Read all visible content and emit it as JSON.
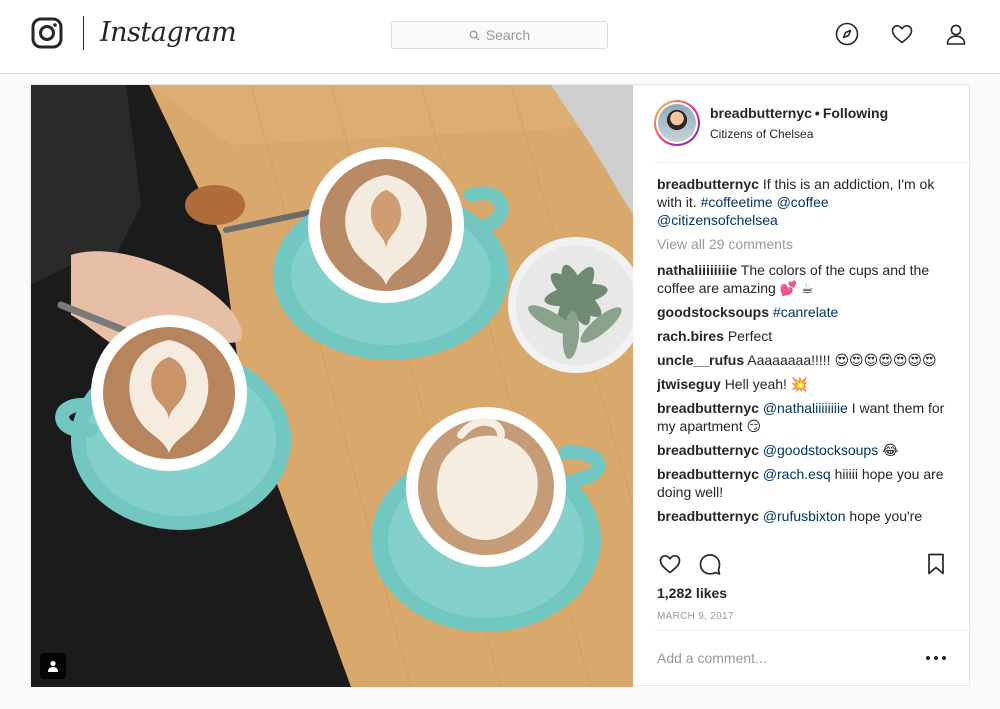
{
  "header": {
    "wordmark": "Instagram",
    "search_placeholder": "Search",
    "icons": [
      "instagram-glyph-icon",
      "compass-icon",
      "heart-icon",
      "profile-icon"
    ]
  },
  "post": {
    "username": "breadbutternyc",
    "separator": "•",
    "follow_status": "Following",
    "location": "Citizens of Chelsea",
    "caption": {
      "user": "breadbutternyc",
      "text": "If this is an addiction, I'm ok with it.",
      "tags": [
        "#coffeetime",
        "@coffee",
        "@citizensofchelsea"
      ]
    },
    "view_all": "View all 29 comments",
    "comments": [
      {
        "user": "nathaliiiiiiiie",
        "text": "The colors of the cups and the coffee are amazing 💕 ☕"
      },
      {
        "user": "goodstocksoups",
        "tag": "#canrelate",
        "text": ""
      },
      {
        "user": "rach.bires",
        "text": "Perfect"
      },
      {
        "user": "uncle__rufus",
        "text": "Aaaaaaaa!!!!! 😍😍😍😍😍😍😍"
      },
      {
        "user": "jtwiseguy",
        "text": "Hell yeah! 💥"
      },
      {
        "user": "breadbutternyc",
        "tag": "@nathaliiiiiiiie",
        "text": "I want them for my apartment 😏"
      },
      {
        "user": "breadbutternyc",
        "tag": "@goodstocksoups",
        "text": "😂"
      },
      {
        "user": "breadbutternyc",
        "tag": "@rach.esq",
        "text": "hiiiii hope you are doing well!"
      },
      {
        "user": "breadbutternyc",
        "tag": "@rufusbixton",
        "text": "hope you're"
      }
    ],
    "likes": "1,282 likes",
    "date": "MARCH 9, 2017",
    "add_comment_placeholder": "Add a comment..."
  },
  "colors": {
    "link": "#003569",
    "muted": "#999999",
    "border": "#dbdbdb",
    "cup_teal": "#6fc6c0",
    "table_wood": "#d9a86c"
  }
}
